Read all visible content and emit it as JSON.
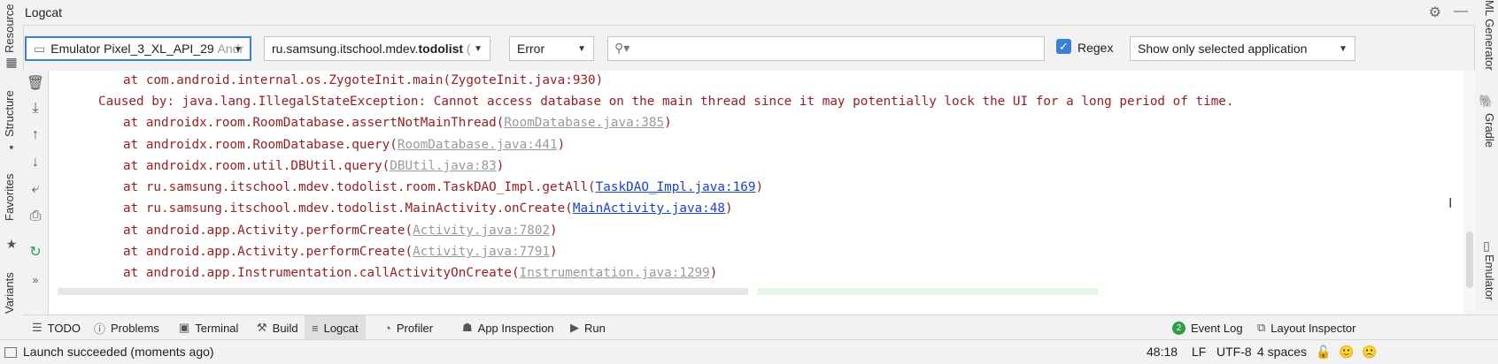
{
  "left_strip": {
    "resource_manager": "Resource Manager",
    "structure": "Structure",
    "favorites": "Favorites",
    "variants": "Variants"
  },
  "right_strip": {
    "ml_generator": "ML Generator",
    "gradle": "Gradle",
    "emulator": "Emulator"
  },
  "header": {
    "title": "Logcat"
  },
  "filters": {
    "device": "Emulator Pixel_3_XL_API_29",
    "device_suffix": "Andr",
    "package_prefix": "ru.samsung.itschool.mdev.",
    "package_bold": "todolist",
    "package_suffix": "(",
    "level": "Error",
    "search_placeholder": "",
    "regex_label": "Regex",
    "app_filter": "Show only selected application"
  },
  "log": {
    "lines": [
      {
        "text": "at com.android.internal.os.ZygoteInit.main(ZygoteInit.java:930)"
      },
      {
        "text": "Caused by: java.lang.IllegalStateException: Cannot access database on the main thread since it may potentially lock the UI for a long period of time."
      },
      {
        "pre": "at androidx.room.RoomDatabase.assertNotMainThread(",
        "link": "RoomDatabase.java:385",
        "post": ")"
      },
      {
        "pre": "at androidx.room.RoomDatabase.query(",
        "link": "RoomDatabase.java:441",
        "post": ")"
      },
      {
        "pre": "at androidx.room.util.DBUtil.query(",
        "link": "DBUtil.java:83",
        "post": ")"
      },
      {
        "pre": "at ru.samsung.itschool.mdev.todolist.room.TaskDAO_Impl.getAll(",
        "link": "TaskDAO_Impl.java:169",
        "post": ")"
      },
      {
        "pre": "at ru.samsung.itschool.mdev.todolist.MainActivity.onCreate(",
        "link": "MainActivity.java:48",
        "post": ")"
      },
      {
        "pre": "at android.app.Activity.performCreate(",
        "link": "Activity.java:7802",
        "post": ")"
      },
      {
        "pre": "at android.app.Activity.performCreate(",
        "link": "Activity.java:7791",
        "post": ")"
      },
      {
        "pre": "at android.app.Instrumentation.callActivityOnCreate(",
        "link": "Instrumentation.java:1299",
        "post": ")"
      }
    ]
  },
  "bottom_tabs": {
    "todo": "TODO",
    "problems": "Problems",
    "terminal": "Terminal",
    "build": "Build",
    "logcat": "Logcat",
    "profiler": "Profiler",
    "app_inspection": "App Inspection",
    "run": "Run",
    "event_log_badge": "2",
    "event_log": "Event Log",
    "layout_inspector": "Layout Inspector"
  },
  "status": {
    "message": "Launch succeeded (moments ago)",
    "position": "48:18",
    "line_sep": "LF",
    "encoding": "UTF-8",
    "indent": "4 spaces"
  },
  "colors": {
    "error_text": "#9a1d1d",
    "link_blue": "#1a3fd6",
    "accent": "#3c7fd6",
    "badge_green": "#2e9e45"
  }
}
